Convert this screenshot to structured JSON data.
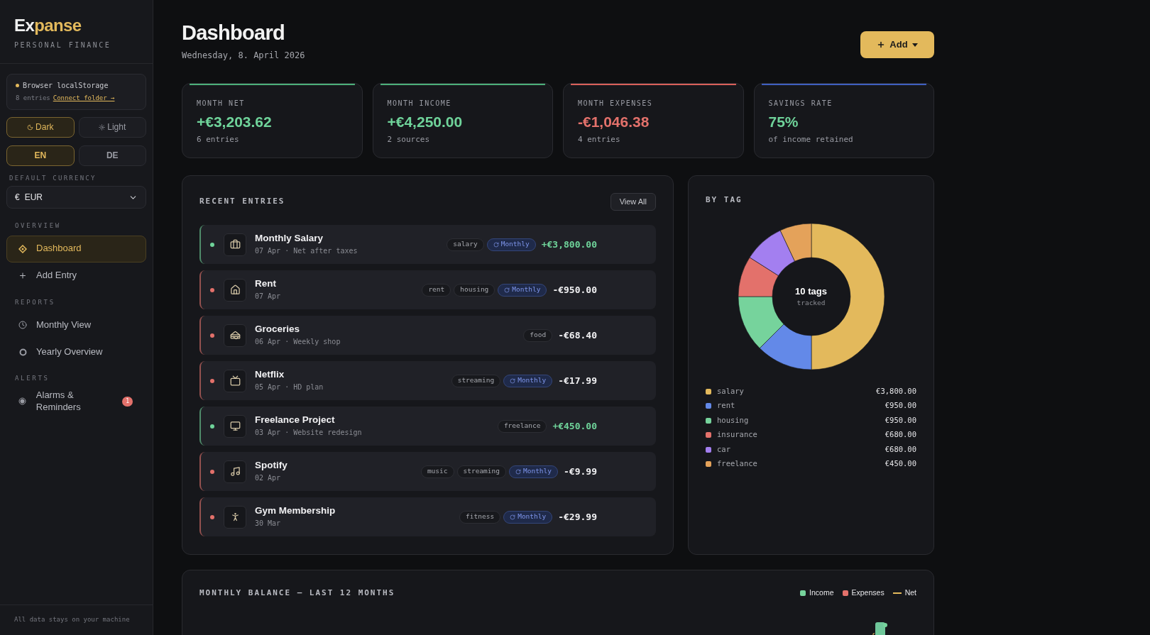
{
  "sidebar": {
    "logo": {
      "lead": "Ex",
      "rest": "panse"
    },
    "subtitle": "PERSONAL FINANCE",
    "storage": {
      "label": "Browser localStorage",
      "count": "8 entries",
      "link": "Connect folder →"
    },
    "themes": [
      {
        "label": "Dark",
        "kind": "dark",
        "selected": true
      },
      {
        "label": "Light",
        "kind": "light",
        "selected": false
      }
    ],
    "languages": [
      {
        "label": "EN",
        "selected": true
      },
      {
        "label": "DE",
        "selected": false
      }
    ],
    "currency": {
      "label": "DEFAULT CURRENCY",
      "symbol": "€",
      "value": "EUR"
    },
    "sections": [
      {
        "heading": "OVERVIEW",
        "items": [
          {
            "label": "Dashboard",
            "kind": "diamond",
            "selected": true
          },
          {
            "label": "Add Entry",
            "kind": "plus",
            "selected": false
          }
        ]
      },
      {
        "heading": "REPORTS",
        "items": [
          {
            "label": "Monthly View",
            "kind": "clock",
            "selected": false
          },
          {
            "label": "Yearly Overview",
            "kind": "ring",
            "selected": false
          }
        ]
      },
      {
        "heading": "ALERTS",
        "items": [
          {
            "label": "Alarms & Reminders",
            "kind": "dot",
            "selected": false,
            "badge": "1"
          }
        ]
      }
    ],
    "footer": "All data stays on your machine"
  },
  "header": {
    "title": "Dashboard",
    "date": "Wednesday, 8. April 2026",
    "add_button": "Add"
  },
  "stats": [
    {
      "label": "MONTH NET",
      "value": "+€3,203.62",
      "note": "6 entries",
      "kind": "net",
      "color": "#6fd39a"
    },
    {
      "label": "MONTH INCOME",
      "value": "+€4,250.00",
      "note": "2 sources",
      "kind": "income",
      "color": "#6fd39a"
    },
    {
      "label": "MONTH EXPENSES",
      "value": "-€1,046.38",
      "note": "4 entries",
      "kind": "expense",
      "color": "#e3716b"
    },
    {
      "label": "SAVINGS RATE",
      "value": "75%",
      "note": "of income retained",
      "kind": "rate",
      "color": "#6fd39a"
    }
  ],
  "recent": {
    "title": "RECENT ENTRIES",
    "view_all": "View All",
    "entries": [
      {
        "title": "Monthly Salary",
        "meta": "07 Apr · Net after taxes",
        "color": "#6fd39a",
        "kind": "income",
        "amount": "+€3,800.00",
        "tags": [
          {
            "label": "salary",
            "kind": "tag"
          },
          {
            "label": "Monthly",
            "kind": "recurring"
          }
        ]
      },
      {
        "title": "Rent",
        "meta": "07 Apr",
        "color": "#e3716b",
        "kind": "expense",
        "amount": "-€950.00",
        "tags": [
          {
            "label": "rent",
            "kind": "tag"
          },
          {
            "label": "housing",
            "kind": "tag"
          },
          {
            "label": "Monthly",
            "kind": "recurring"
          }
        ]
      },
      {
        "title": "Groceries",
        "meta": "06 Apr · Weekly shop",
        "color": "#e3716b",
        "kind": "expense",
        "amount": "-€68.40",
        "tags": [
          {
            "label": "food",
            "kind": "tag"
          }
        ]
      },
      {
        "title": "Netflix",
        "meta": "05 Apr · HD plan",
        "color": "#e3716b",
        "kind": "expense",
        "amount": "-€17.99",
        "tags": [
          {
            "label": "streaming",
            "kind": "tag"
          },
          {
            "label": "Monthly",
            "kind": "recurring"
          }
        ]
      },
      {
        "title": "Freelance Project",
        "meta": "03 Apr · Website redesign",
        "color": "#6fd39a",
        "kind": "income",
        "amount": "+€450.00",
        "tags": [
          {
            "label": "freelance",
            "kind": "tag"
          }
        ]
      },
      {
        "title": "Spotify",
        "meta": "02 Apr",
        "color": "#e3716b",
        "kind": "expense",
        "amount": "-€9.99",
        "tags": [
          {
            "label": "music",
            "kind": "tag"
          },
          {
            "label": "streaming",
            "kind": "tag"
          },
          {
            "label": "Monthly",
            "kind": "recurring"
          }
        ]
      },
      {
        "title": "Gym Membership",
        "meta": "30 Mar",
        "color": "#e3716b",
        "kind": "expense",
        "amount": "-€29.99",
        "tags": [
          {
            "label": "fitness",
            "kind": "tag"
          },
          {
            "label": "Monthly",
            "kind": "recurring"
          }
        ]
      }
    ]
  },
  "by_tag": {
    "title": "BY TAG",
    "center_value": "10 tags",
    "center_label": "tracked",
    "chart_data": {
      "type": "donut",
      "categories": [
        "salary",
        "rent",
        "housing",
        "insurance",
        "car",
        "freelance"
      ],
      "values": [
        50,
        12.5,
        12.5,
        9,
        9,
        7
      ]
    },
    "legend": [
      {
        "amount": "€3,800.00",
        "color": "#e3b95c"
      },
      {
        "amount": "€950.00",
        "color": "#6389e8"
      },
      {
        "amount": "€950.00",
        "color": "#76d39c"
      },
      {
        "amount": "€680.00",
        "color": "#e3716b"
      },
      {
        "amount": "€680.00",
        "color": "#a37ff0"
      },
      {
        "amount": "€450.00",
        "color": "#e4a25a"
      }
    ]
  },
  "balance": {
    "title": "MONTHLY BALANCE — LAST 12 MONTHS",
    "legend": [
      {
        "label": "Income",
        "kind": "bar",
        "color": "#76d39c"
      },
      {
        "label": "Expenses",
        "kind": "bar",
        "color": "#e3716b"
      },
      {
        "label": "Net",
        "kind": "line",
        "color": "#e3b95c"
      }
    ]
  }
}
